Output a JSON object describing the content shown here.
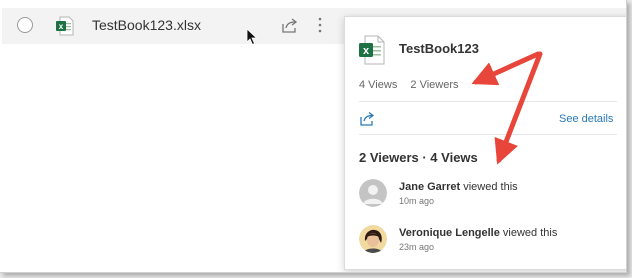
{
  "file_row": {
    "name": "TestBook123.xlsx",
    "file_type_icon": "excel-file-icon",
    "share_icon": "share-icon",
    "more_icon": "vertical-ellipsis-icon"
  },
  "panel": {
    "title": "TestBook123",
    "views_stat": "4 Views",
    "viewers_stat": "2 Viewers",
    "see_details": "See details",
    "summary": "2 Viewers · 4 Views",
    "viewers": [
      {
        "name": "Jane Garret",
        "action": "viewed this",
        "time": "10m ago",
        "avatar": "default-avatar-icon"
      },
      {
        "name": "Veronique Lengelle",
        "action": "viewed this",
        "time": "23m ago",
        "avatar": "profile-photo"
      }
    ]
  },
  "colors": {
    "accent": "#2a7ab8",
    "annotation_arrow": "#e8463a",
    "excel_green": "#1e7145"
  }
}
